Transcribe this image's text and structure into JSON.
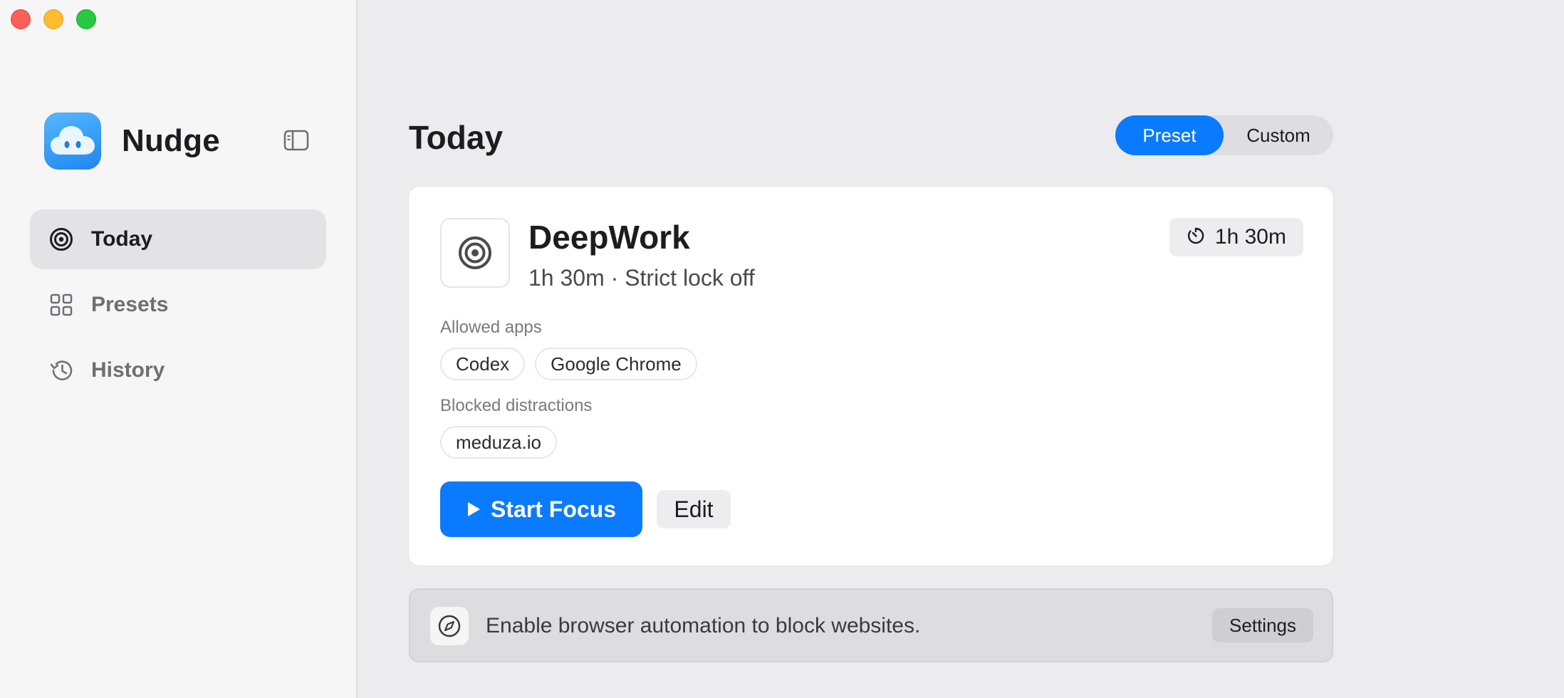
{
  "app": {
    "name": "Nudge"
  },
  "sidebar": {
    "items": [
      {
        "label": "Today",
        "icon": "target-icon",
        "active": true
      },
      {
        "label": "Presets",
        "icon": "grid-icon",
        "active": false
      },
      {
        "label": "History",
        "icon": "history-icon",
        "active": false
      }
    ]
  },
  "main": {
    "title": "Today",
    "mode_toggle": {
      "options": [
        "Preset",
        "Custom"
      ],
      "selected": "Preset"
    },
    "preset_card": {
      "name": "DeepWork",
      "subtitle": "1h 30m · Strict lock off",
      "duration": "1h 30m",
      "allowed_label": "Allowed apps",
      "allowed_apps": [
        "Codex",
        "Google Chrome"
      ],
      "blocked_label": "Blocked distractions",
      "blocked_sites": [
        "meduza.io"
      ],
      "start_label": "Start Focus",
      "edit_label": "Edit"
    },
    "banner": {
      "text": "Enable browser automation to block websites.",
      "button_label": "Settings"
    }
  },
  "colors": {
    "accent": "#0a7aff",
    "sidebar_bg": "#f6f6f6",
    "main_bg": "#ececee"
  }
}
